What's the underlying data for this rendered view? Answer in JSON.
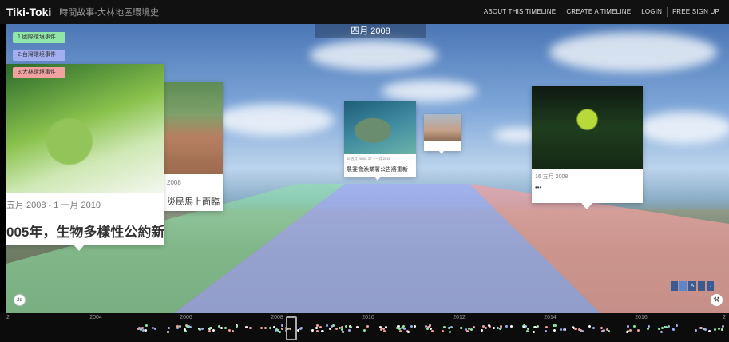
{
  "app": {
    "brand": "Tiki-Toki",
    "subtitle": "時間故事-大林地區環境史",
    "nav": [
      "ABOUT THIS TIMELINE",
      "CREATE A TIMELINE",
      "LOGIN",
      "FREE SIGN UP"
    ]
  },
  "current_date": "四月 2008",
  "categories": [
    {
      "label": "1.國際環境事件",
      "color": "#8fe6a8"
    },
    {
      "label": "2.台灣環境事件",
      "color": "#a3aef1"
    },
    {
      "label": "3.大林環境事件",
      "color": "#f2a0a0"
    }
  ],
  "cards": [
    {
      "date": "五月 2008 - 1 一月 2010",
      "title": "005年，生物多樣性公約新"
    },
    {
      "date": "2008",
      "title": "災民馬上面臨"
    },
    {
      "date": "10 五月 2008 - 27 十一月 2018",
      "title": "農委會漁業署公告將重新"
    },
    {
      "date": "",
      "title": ""
    },
    {
      "date": "16 五月 2008",
      "title": "•••"
    }
  ],
  "controls": {
    "mode_2d": "2d",
    "view_segments": [
      "",
      "",
      "A",
      "",
      ":"
    ]
  },
  "timeline": {
    "years": [
      "2",
      "2004",
      "2006",
      "2008",
      "2010",
      "2012",
      "2014",
      "2016",
      "2"
    ]
  },
  "colors": {
    "green": "#8fe6a8",
    "blue": "#a3aef1",
    "red": "#f2a0a0"
  }
}
